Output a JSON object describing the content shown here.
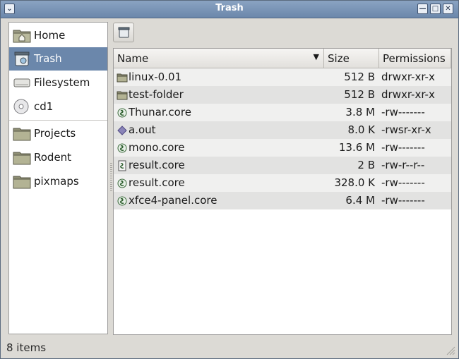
{
  "window": {
    "title": "Trash"
  },
  "sidebar": {
    "items": [
      {
        "label": "Home",
        "icon": "home-folder-icon"
      },
      {
        "label": "Trash",
        "icon": "trash-icon",
        "selected": true
      },
      {
        "label": "Filesystem",
        "icon": "harddisk-icon"
      },
      {
        "label": "cd1",
        "icon": "cdrom-icon"
      }
    ],
    "bookmarks": [
      {
        "label": "Projects",
        "icon": "folder-icon"
      },
      {
        "label": "Rodent",
        "icon": "folder-icon"
      },
      {
        "label": "pixmaps",
        "icon": "folder-icon"
      }
    ]
  },
  "toolbar": {
    "location_button_icon": "trash-icon"
  },
  "columns": {
    "name": "Name",
    "size": "Size",
    "permissions": "Permissions"
  },
  "files": [
    {
      "name": "linux-0.01",
      "size": "512 B",
      "permissions": "drwxr-xr-x",
      "icon": "folder-icon"
    },
    {
      "name": "test-folder",
      "size": "512 B",
      "permissions": "drwxr-xr-x",
      "icon": "folder-icon"
    },
    {
      "name": "Thunar.core",
      "size": "3.8 M",
      "permissions": "-rw-------",
      "icon": "core-dump-icon"
    },
    {
      "name": "a.out",
      "size": "8.0 K",
      "permissions": "-rwsr-xr-x",
      "icon": "executable-icon"
    },
    {
      "name": "mono.core",
      "size": "13.6 M",
      "permissions": "-rw-------",
      "icon": "core-dump-icon"
    },
    {
      "name": "result.core",
      "size": "2 B",
      "permissions": "-rw-r--r--",
      "icon": "core-document-icon"
    },
    {
      "name": "result.core",
      "size": "328.0 K",
      "permissions": "-rw-------",
      "icon": "core-dump-icon"
    },
    {
      "name": "xfce4-panel.core",
      "size": "6.4 M",
      "permissions": "-rw-------",
      "icon": "core-dump-icon"
    }
  ],
  "status": {
    "text": "8 items"
  },
  "colors": {
    "title_bar": "#6b87ab",
    "selection": "#6b87ab",
    "row_odd": "#f0f0ef",
    "row_even": "#e2e2e1"
  }
}
